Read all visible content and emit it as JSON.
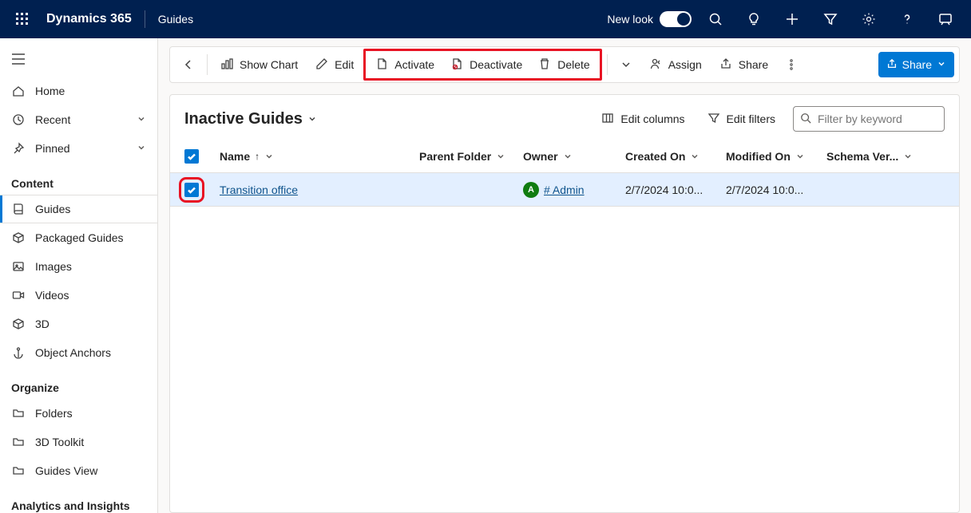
{
  "topbar": {
    "brand": "Dynamics 365",
    "module": "Guides",
    "new_look_label": "New look"
  },
  "sidebar": {
    "top": [
      {
        "id": "home",
        "label": "Home"
      },
      {
        "id": "recent",
        "label": "Recent",
        "expandable": true
      },
      {
        "id": "pinned",
        "label": "Pinned",
        "expandable": true
      }
    ],
    "sections": [
      {
        "title": "Content",
        "items": [
          {
            "id": "guides",
            "label": "Guides",
            "active": true
          },
          {
            "id": "packaged-guides",
            "label": "Packaged Guides"
          },
          {
            "id": "images",
            "label": "Images"
          },
          {
            "id": "videos",
            "label": "Videos"
          },
          {
            "id": "3d",
            "label": "3D"
          },
          {
            "id": "object-anchors",
            "label": "Object Anchors"
          }
        ]
      },
      {
        "title": "Organize",
        "items": [
          {
            "id": "folders",
            "label": "Folders"
          },
          {
            "id": "3d-toolkit",
            "label": "3D Toolkit"
          },
          {
            "id": "guides-view",
            "label": "Guides View"
          }
        ]
      },
      {
        "title": "Analytics and Insights",
        "items": []
      }
    ]
  },
  "commands": {
    "show_chart": "Show Chart",
    "edit": "Edit",
    "activate": "Activate",
    "deactivate": "Deactivate",
    "delete": "Delete",
    "assign": "Assign",
    "share": "Share",
    "share_primary": "Share"
  },
  "view": {
    "title": "Inactive Guides",
    "edit_columns": "Edit columns",
    "edit_filters": "Edit filters",
    "search_placeholder": "Filter by keyword"
  },
  "columns": {
    "name": "Name",
    "parent": "Parent Folder",
    "owner": "Owner",
    "created": "Created On",
    "modified": "Modified On",
    "schema": "Schema Ver...",
    "sort_arrow": "↑"
  },
  "rows": [
    {
      "checked": true,
      "name": "Transition office",
      "owner_initial": "A",
      "owner": "# Admin",
      "created": "2/7/2024 10:0...",
      "modified": "2/7/2024 10:0..."
    }
  ]
}
